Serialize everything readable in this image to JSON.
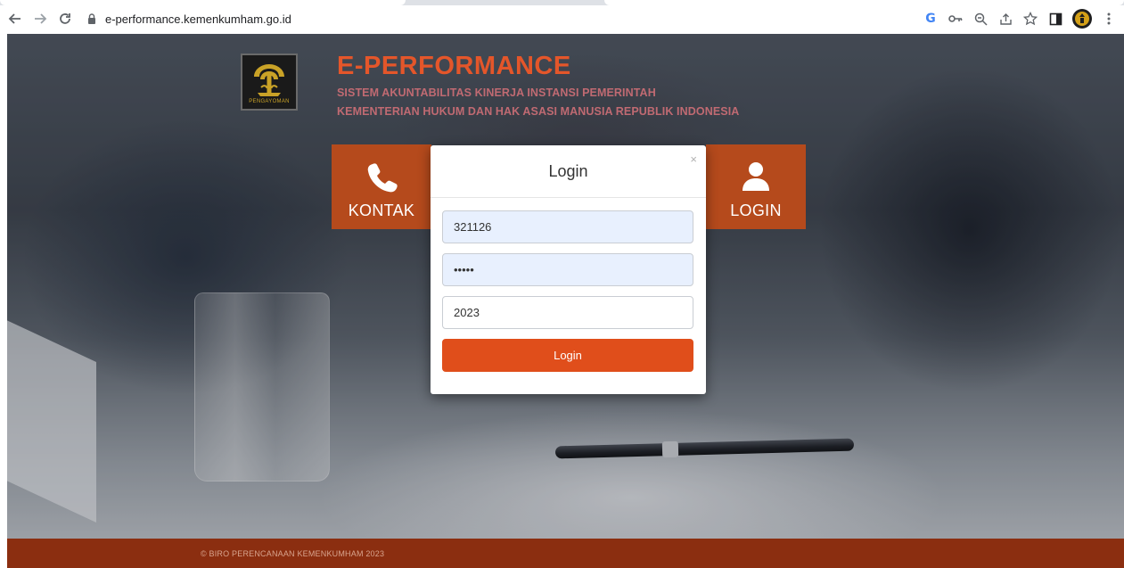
{
  "browser": {
    "url": "e-performance.kemenkumham.go.id"
  },
  "header": {
    "title": "E-PERFORMANCE",
    "subtitle1": "SISTEM AKUNTABILITAS KINERJA INSTANSI PEMERINTAH",
    "subtitle2": "KEMENTERIAN HUKUM DAN HAK ASASI MANUSIA REPUBLIK INDONESIA",
    "logo_text": "PENGAYOMAN"
  },
  "tiles": {
    "kontak": "KONTAK",
    "login": "LOGIN"
  },
  "modal": {
    "title": "Login",
    "close": "×",
    "username_value": "321126",
    "password_value": "•••••",
    "year_value": "2023",
    "submit_label": "Login"
  },
  "footer": {
    "text": "© BIRO PERENCANAAN KEMENKUMHAM 2023"
  },
  "colors": {
    "accent": "#e04e1b",
    "tile": "#b54a1c",
    "footer": "#8b2e10",
    "autofill": "#e8f0fe"
  }
}
